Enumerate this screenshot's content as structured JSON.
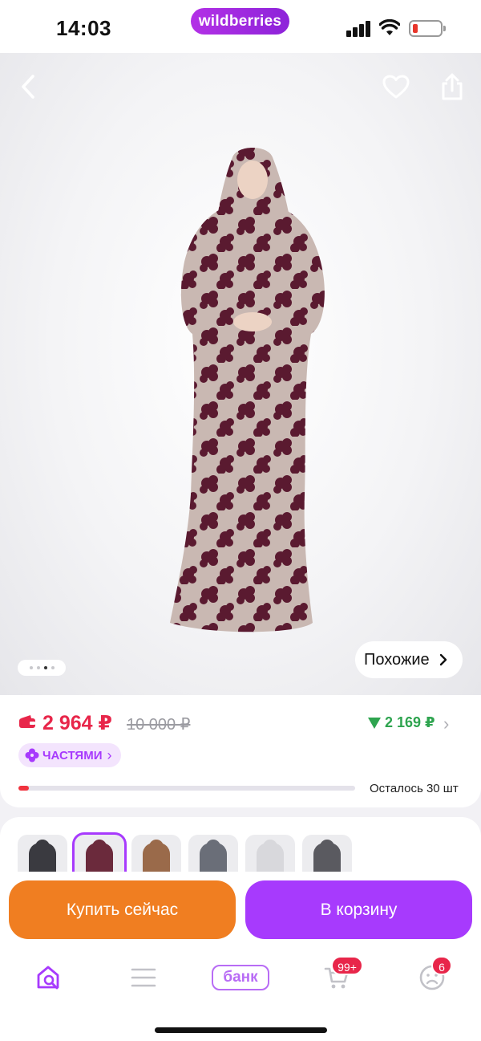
{
  "status_bar": {
    "time": "14:03",
    "app_logo": "wildberries",
    "battery_color": "#e8362b"
  },
  "product_view": {
    "back_icon": "chevron-left-icon",
    "favorite_icon": "heart-icon",
    "share_icon": "share-icon",
    "image_count": 4,
    "active_image_index": 2,
    "similar_label": "Похожие"
  },
  "pricing": {
    "current_price": "2 964 ₽",
    "old_price": "10 000 ₽",
    "wallet_price": "2 169 ₽",
    "installments_label": "ЧАСТЯМИ",
    "stock_label": "Осталось 30 шт",
    "stock_fraction": 0.03
  },
  "thumbnails": {
    "selected_index": 1,
    "items": [
      {
        "color": "#3a3a40"
      },
      {
        "color": "#6b2a3c"
      },
      {
        "color": "#9a6a4a"
      },
      {
        "color": "#6a6e78"
      },
      {
        "color": "#d8d8dc"
      },
      {
        "color": "#5a5a60"
      }
    ]
  },
  "actions": {
    "buy_now": "Купить сейчас",
    "add_to_cart": "В корзину"
  },
  "bottom_nav": {
    "bank_label": "банк",
    "cart_badge": "99+",
    "profile_badge": "6",
    "accent_color": "#a73afd"
  },
  "colors": {
    "price_red": "#e8264a",
    "wallet_green": "#2ea44f",
    "buy_orange": "#f07e21",
    "cart_purple": "#a73afd"
  }
}
